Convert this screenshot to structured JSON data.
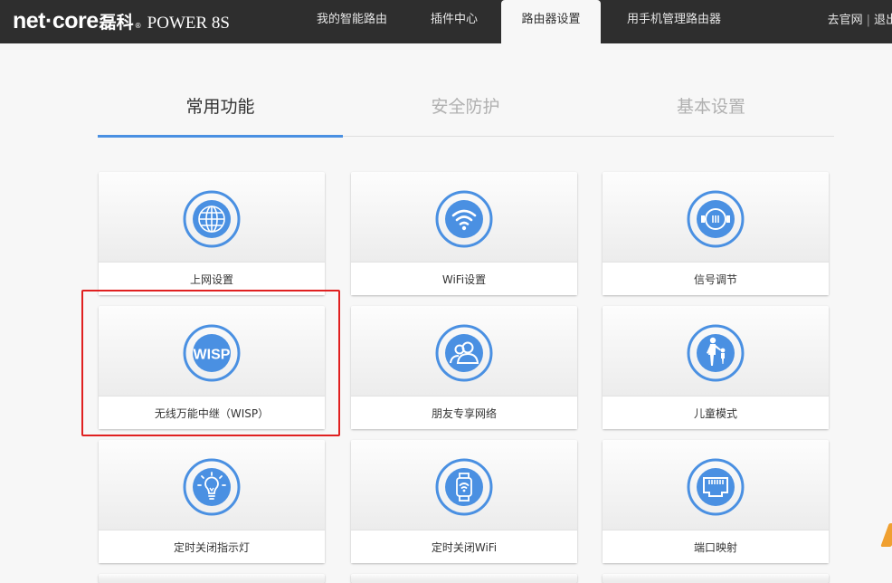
{
  "header": {
    "logo": "net·core",
    "brand_cn": "磊科",
    "registered": "®",
    "model": "POWER 8S",
    "nav": [
      {
        "label": "我的智能路由"
      },
      {
        "label": "插件中心"
      },
      {
        "label": "路由器设置"
      },
      {
        "label": "用手机管理路由器"
      }
    ],
    "links": {
      "official_site": "去官网",
      "separator": "|",
      "logout": "退出"
    }
  },
  "tabs": [
    {
      "label": "常用功能"
    },
    {
      "label": "安全防护"
    },
    {
      "label": "基本设置"
    }
  ],
  "colors": {
    "accent": "#4a90e2",
    "highlight": "#e02020"
  },
  "cards": [
    {
      "label": "上网设置",
      "icon": "globe-icon"
    },
    {
      "label": "WiFi设置",
      "icon": "wifi-icon"
    },
    {
      "label": "信号调节",
      "icon": "signal-tuner-icon"
    },
    {
      "label": "无线万能中继（WISP）",
      "icon": "wisp-icon",
      "icon_text": "WISP"
    },
    {
      "label": "朋友专享网络",
      "icon": "friends-icon"
    },
    {
      "label": "儿童模式",
      "icon": "child-icon"
    },
    {
      "label": "定时关闭指示灯",
      "icon": "bulb-icon"
    },
    {
      "label": "定时关闭WiFi",
      "icon": "watch-wifi-icon"
    },
    {
      "label": "端口映射",
      "icon": "ethernet-port-icon"
    }
  ]
}
